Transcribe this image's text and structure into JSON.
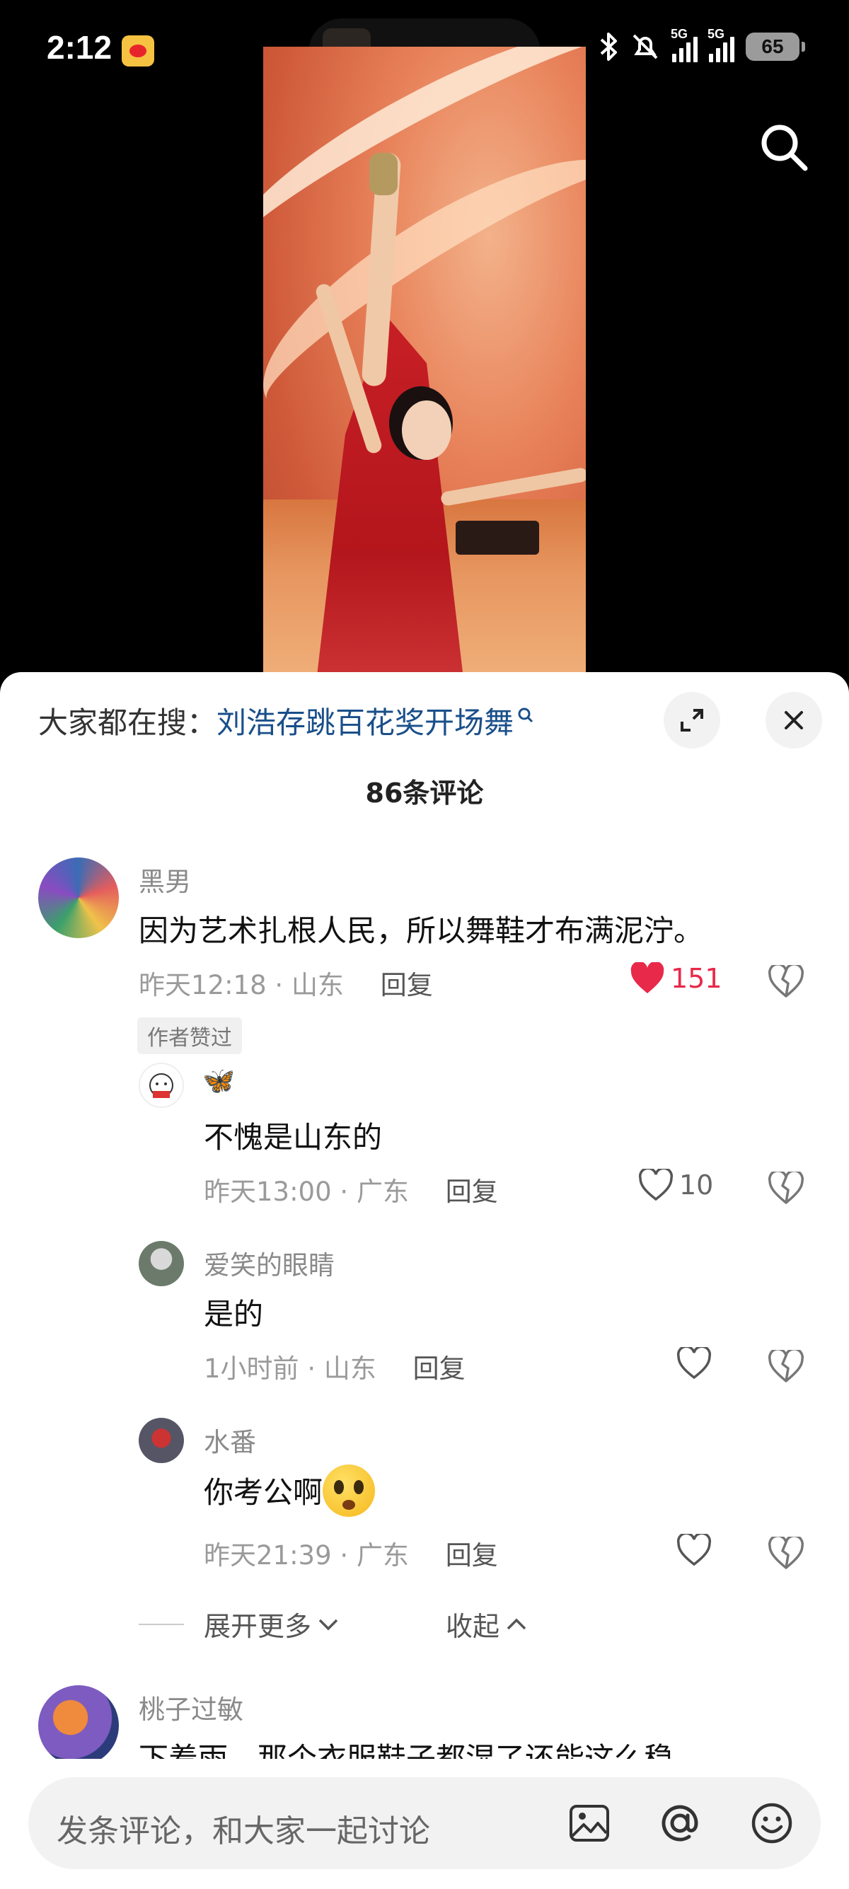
{
  "status_bar": {
    "time": "2:12",
    "network1": "5G",
    "network2": "5G",
    "battery": "65"
  },
  "hot_search": {
    "prefix": "大家都在搜：",
    "keyword": "刘浩存跳百花奖开场舞"
  },
  "comment_count": "86条评论",
  "comments": [
    {
      "name": "黑男",
      "text": "因为艺术扎根人民，所以舞鞋才布满泥泞。",
      "time": "昨天12:18",
      "location": "山东",
      "reply_label": "回复",
      "likes": "151",
      "badge": "作者赞过",
      "replies": [
        {
          "name": "🦋",
          "text": "不愧是山东的",
          "time": "昨天13:00",
          "location": "广东",
          "reply_label": "回复",
          "likes": "10"
        },
        {
          "name": "爱笑的眼睛",
          "text": "是的",
          "time": "1小时前",
          "location": "山东",
          "reply_label": "回复",
          "likes": ""
        },
        {
          "name": "水番",
          "text": "你考公啊",
          "time": "昨天21:39",
          "location": "广东",
          "reply_label": "回复",
          "likes": ""
        }
      ]
    },
    {
      "name": "桃子过敏",
      "text": "下着雨，那个衣服鞋子都湿了还能这么稳"
    }
  ],
  "expand_more": "展开更多",
  "collapse": "收起",
  "composer": {
    "placeholder": "发条评论，和大家一起讨论"
  },
  "colors": {
    "accent_like": "#e8294a",
    "keyword": "#1a4f8a"
  }
}
